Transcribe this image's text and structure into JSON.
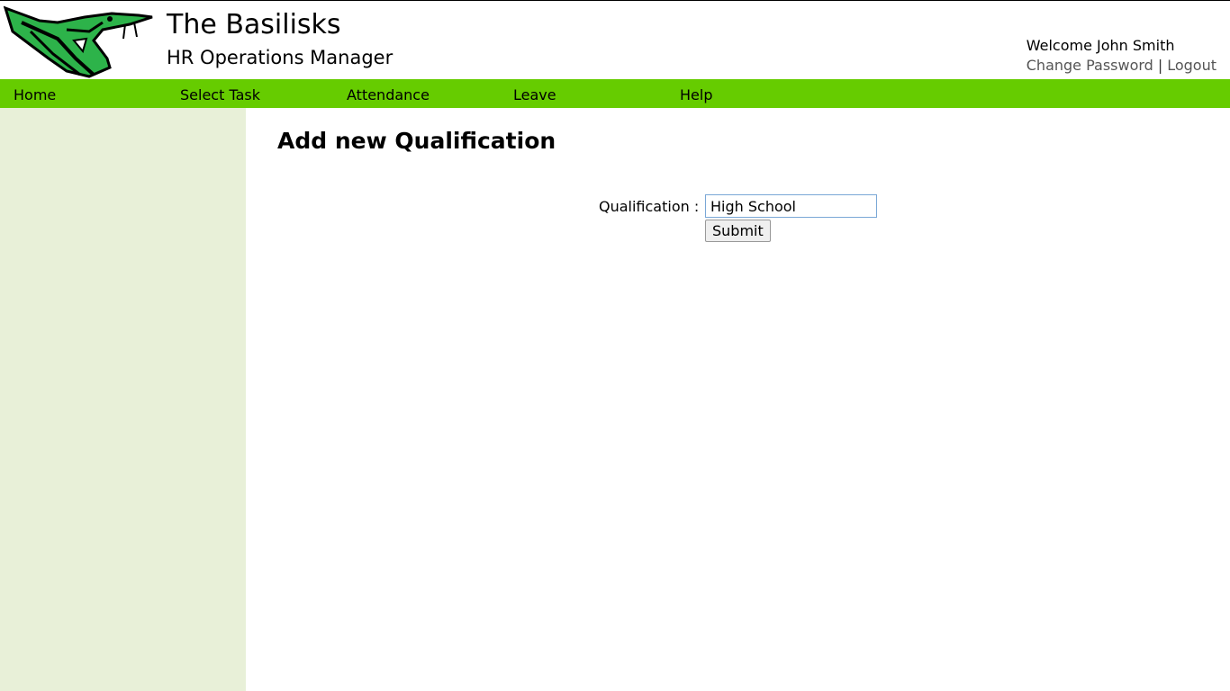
{
  "header": {
    "title": "The Basilisks",
    "subtitle": "HR Operations Manager",
    "logo_icon": "basilisk-snake-logo",
    "welcome": "Welcome John Smith",
    "change_password": "Change Password",
    "separator": "|",
    "logout": "Logout"
  },
  "nav": {
    "home": "Home",
    "select_task": "Select Task",
    "attendance": "Attendance",
    "leave": "Leave",
    "help": "Help"
  },
  "main": {
    "title": "Add new Qualification",
    "qualification_label": "Qualification :",
    "qualification_value": "High School",
    "submit": "Submit"
  },
  "colors": {
    "nav_bg": "#66cc00",
    "sidebar_bg": "#e8f0d8",
    "logo_green": "#2db34a"
  }
}
